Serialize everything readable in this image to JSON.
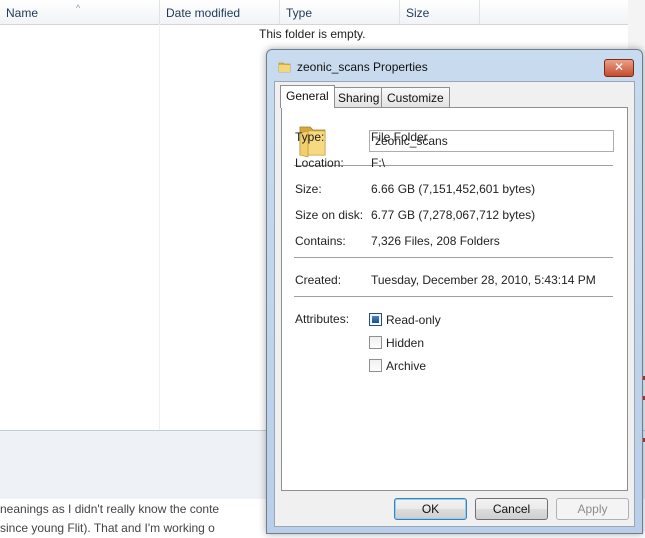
{
  "explorer": {
    "columns": [
      "Name",
      "Date modified",
      "Type",
      "Size"
    ],
    "empty_message": "This folder is empty."
  },
  "background_text": {
    "line1": "neanings as I didn't really know the conte",
    "line2": "since young Flit). That and I'm working o"
  },
  "dialog": {
    "title": "zeonic_scans Properties",
    "close_label": "✕",
    "tabs": [
      "General",
      "Sharing",
      "Customize"
    ],
    "folder_name": "zeonic_scans",
    "fields": {
      "type_label": "Type:",
      "type_value": "File Folder",
      "location_label": "Location:",
      "location_value": "F:\\",
      "size_label": "Size:",
      "size_value": "6.66 GB (7,151,452,601 bytes)",
      "size_on_disk_label": "Size on disk:",
      "size_on_disk_value": "6.77 GB (7,278,067,712 bytes)",
      "contains_label": "Contains:",
      "contains_value": "7,326 Files, 208 Folders",
      "created_label": "Created:",
      "created_value": "Tuesday, December 28, 2010, 5:43:14 PM",
      "attributes_label": "Attributes:"
    },
    "attributes": [
      {
        "label": "Read-only",
        "checked": true
      },
      {
        "label": "Hidden",
        "checked": false
      },
      {
        "label": "Archive",
        "checked": false
      }
    ],
    "buttons": {
      "ok": "OK",
      "cancel": "Cancel",
      "apply": "Apply"
    }
  },
  "icons": {
    "title": "folder-icon",
    "big": "folder-icon"
  },
  "colors": {
    "accent": "#3c7fb1",
    "folder": "#e8c35a"
  }
}
